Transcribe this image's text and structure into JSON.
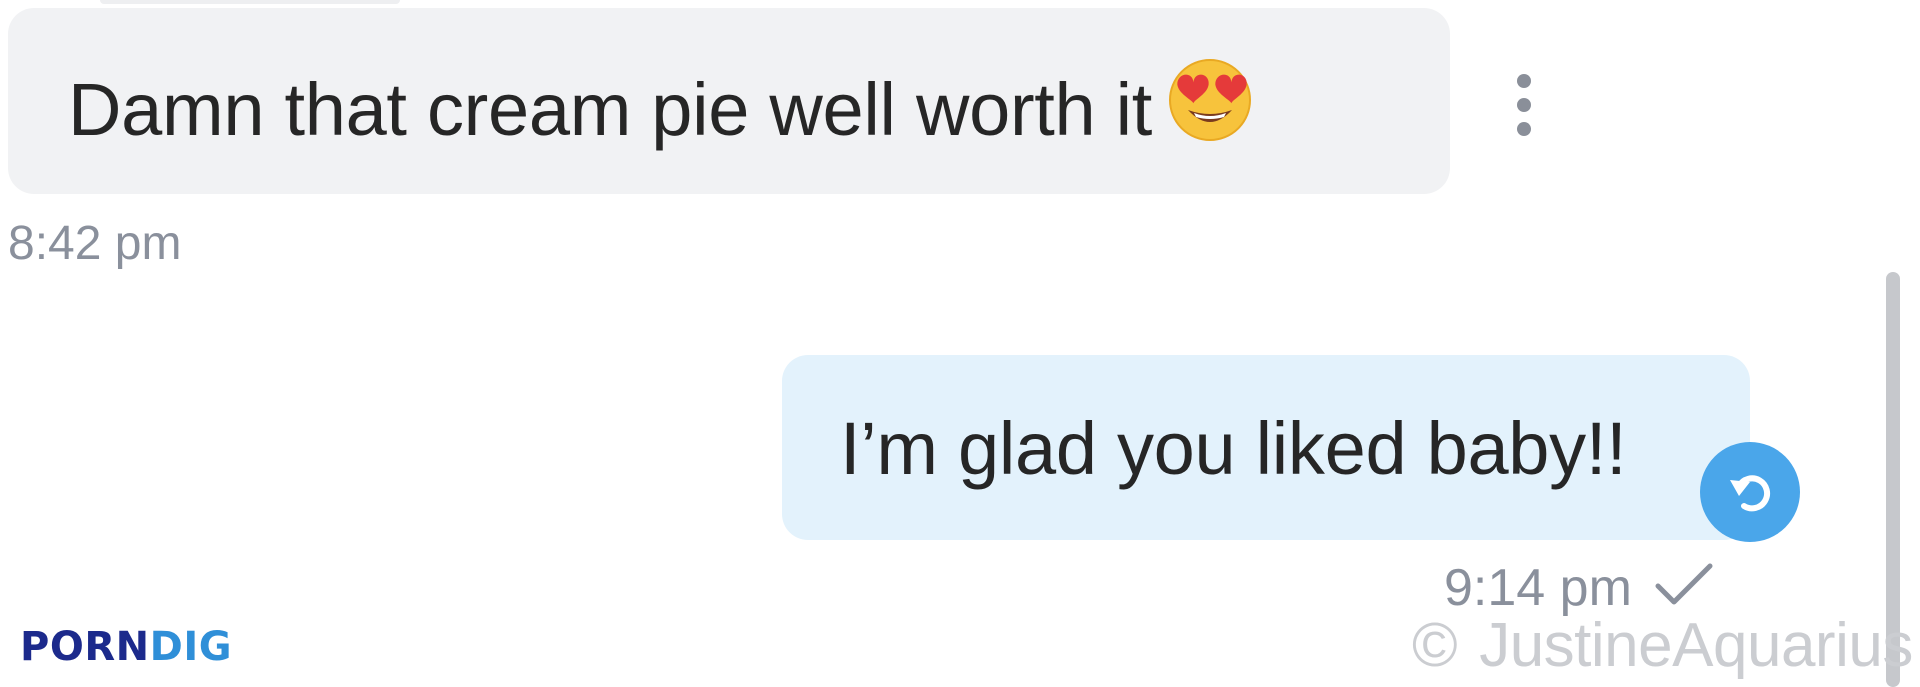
{
  "conversation": {
    "incoming": {
      "text": "Damn that cream pie well worth it",
      "emoji": "heart-eyes-emoji",
      "timestamp": "8:42 pm"
    },
    "outgoing": {
      "text": "I’m glad you liked baby!!",
      "timestamp": "9:14 pm",
      "status": "check-icon",
      "badge": "reply-icon"
    }
  },
  "watermark": {
    "symbol": "©",
    "text": "JustineAquarius"
  },
  "logo": {
    "part1": "PORN",
    "part2": "DIG"
  },
  "colors": {
    "incoming_bubble": "#f1f2f4",
    "outgoing_bubble": "#e3f2fc",
    "reply_badge": "#4aa6ea",
    "timestamp": "#8a909c",
    "logo_dark": "#1c2a8c",
    "logo_light": "#2f8fd8"
  }
}
